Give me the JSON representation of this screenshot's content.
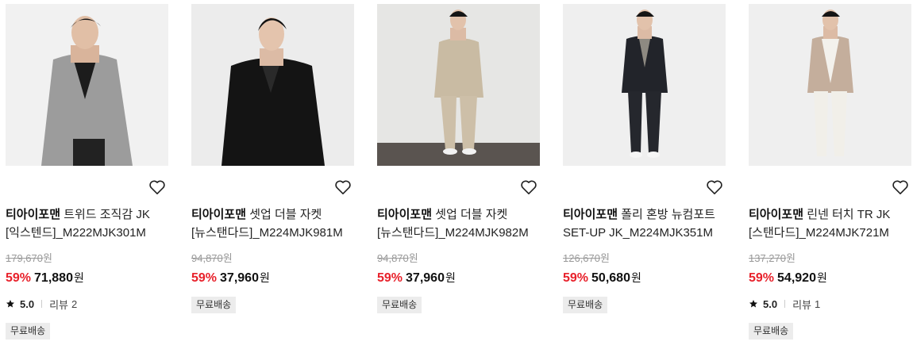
{
  "colors": {
    "discount": "#e8212b",
    "badge_bg": "#ececec",
    "strike": "#999999"
  },
  "currency": "원",
  "products": [
    {
      "brand": "티아이포맨",
      "name": "트위드 조직감 JK [익스텐드]_M222MJK301M",
      "original_price": "179,670",
      "discount": "59%",
      "price": "71,880",
      "rating": "5.0",
      "review_label": "리뷰",
      "review_count": "2",
      "badge": "무료배송"
    },
    {
      "brand": "티아이포맨",
      "name": "셋업 더블 자켓[뉴스탠다드]_M224MJK981M",
      "original_price": "94,870",
      "discount": "59%",
      "price": "37,960",
      "badge": "무료배송"
    },
    {
      "brand": "티아이포맨",
      "name": "셋업 더블 자켓[뉴스탠다드]_M224MJK982M",
      "original_price": "94,870",
      "discount": "59%",
      "price": "37,960",
      "badge": "무료배송"
    },
    {
      "brand": "티아이포맨",
      "name": "폴리 혼방 뉴컴포트 SET-UP JK_M224MJK351M",
      "original_price": "126,670",
      "discount": "59%",
      "price": "50,680",
      "badge": "무료배송"
    },
    {
      "brand": "티아이포맨",
      "name": "린넨 터치 TR JK [스탠다드]_M224MJK721M",
      "original_price": "137,270",
      "discount": "59%",
      "price": "54,920",
      "rating": "5.0",
      "review_label": "리뷰",
      "review_count": "1",
      "badge": "무료배송"
    }
  ]
}
